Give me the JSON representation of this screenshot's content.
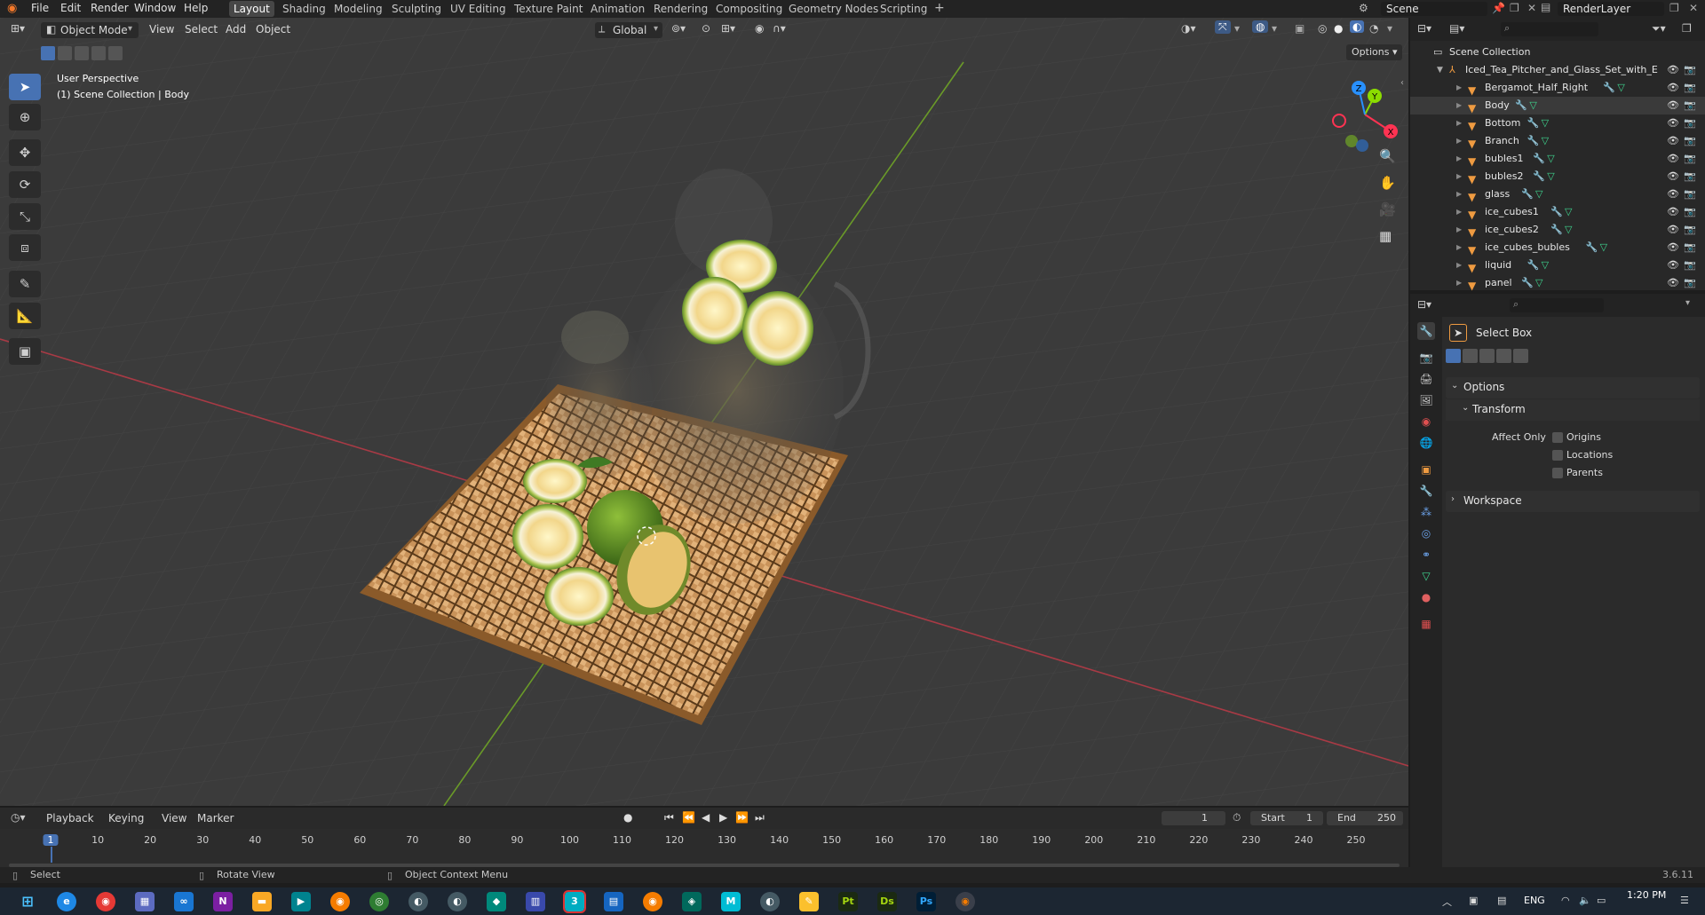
{
  "menu": [
    "File",
    "Edit",
    "Render",
    "Window",
    "Help"
  ],
  "workspaces": [
    "Layout",
    "Shading",
    "Modeling",
    "Sculpting",
    "UV Editing",
    "Texture Paint",
    "Animation",
    "Rendering",
    "Compositing",
    "Geometry Nodes",
    "Scripting"
  ],
  "active_workspace": "Layout",
  "scene_name": "Scene",
  "render_layer": "RenderLayer",
  "viewport": {
    "mode": "Object Mode",
    "menus": [
      "View",
      "Select",
      "Add",
      "Object"
    ],
    "transform_orientation": "Global",
    "options_label": "Options",
    "overlay_title": "User Perspective",
    "overlay_subtitle": "(1) Scene Collection | Body",
    "gizmo_axes": [
      "X",
      "Y",
      "Z"
    ]
  },
  "outliner": {
    "root": "Scene Collection",
    "collection": "Iced_Tea_Pitcher_and_Glass_Set_with_E",
    "items": [
      "Bergamot_Half_Right",
      "Body",
      "Bottom",
      "Branch",
      "bubles1",
      "bubles2",
      "glass",
      "ice_cubes1",
      "ice_cubes2",
      "ice_cubes_bubles",
      "liquid",
      "panel"
    ]
  },
  "properties": {
    "tool_name": "Select Box",
    "options_label": "Options",
    "transform_label": "Transform",
    "affect_only_label": "Affect Only",
    "checkboxes": [
      "Origins",
      "Locations",
      "Parents"
    ],
    "workspace_label": "Workspace"
  },
  "timeline": {
    "menus": [
      "Playback",
      "Keying",
      "View",
      "Marker"
    ],
    "current_frame": "1",
    "start_label": "Start",
    "start": "1",
    "end_label": "End",
    "end": "250",
    "ticks": [
      "1",
      "10",
      "20",
      "30",
      "40",
      "50",
      "60",
      "70",
      "80",
      "90",
      "100",
      "110",
      "120",
      "130",
      "140",
      "150",
      "160",
      "170",
      "180",
      "190",
      "200",
      "210",
      "220",
      "230",
      "240",
      "250"
    ]
  },
  "status": {
    "select": "Select",
    "rotate": "Rotate View",
    "context": "Object Context Menu",
    "version": "3.6.11"
  },
  "taskbar": {
    "language": "ENG",
    "time": "1:20 PM",
    "app_labels": [
      "N",
      "3",
      "Pt",
      "Ds",
      "Ps",
      "M"
    ]
  },
  "colors": {
    "accent": "#4772b3",
    "x_axis": "#ff3352",
    "y_axis": "#8bdc00",
    "z_axis": "#2890ff",
    "object_orange": "#ef9b41",
    "mesh_green": "#3fd68f"
  }
}
